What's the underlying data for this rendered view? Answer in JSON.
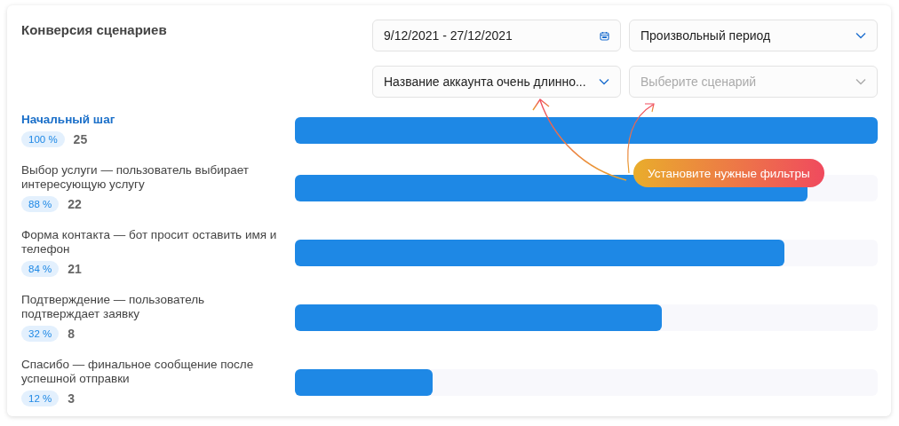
{
  "title": "Конверсия сценариев",
  "filters": [
    {
      "kind": "date",
      "value": "9/12/2021 - 27/12/2021"
    },
    {
      "kind": "select",
      "value": "Произвольный период"
    },
    {
      "kind": "select",
      "value": "Название аккаунта очень длинно..."
    },
    {
      "kind": "select",
      "placeholder": "Выберите сценарий"
    }
  ],
  "steps": [
    {
      "name": "Начальный шаг",
      "selected": true,
      "percent": "100 %",
      "count": "25",
      "level": 1.0
    },
    {
      "name": "Выбор услуги — пользователь выбирает интересующую услугу",
      "selected": false,
      "percent": "88 %",
      "count": "22",
      "level": 0.88
    },
    {
      "name": "Форма контакта — бот просит оставить имя и телефон",
      "selected": false,
      "percent": "84 %",
      "count": "21",
      "level": 0.84
    },
    {
      "name": "Подтверждение — пользователь подтверждает заявку",
      "selected": false,
      "percent": "32 %",
      "count": "8",
      "level": 0.63
    },
    {
      "name": "Спасибо — финальное сообщение после успешной отправки",
      "selected": false,
      "percent": "12 %",
      "count": "3",
      "level": 0.236
    }
  ],
  "callout": {
    "text": "Установите нужные фильтры"
  }
}
